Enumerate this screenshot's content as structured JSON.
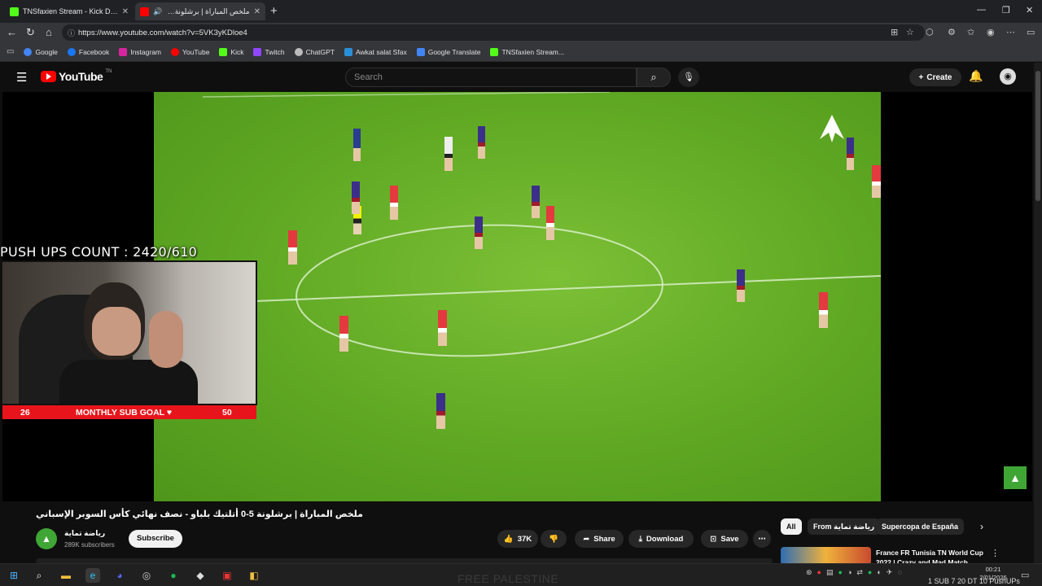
{
  "browser": {
    "tabs": [
      {
        "title": "TNSfaxien Stream - Kick Dashboar",
        "color": "#53fc18"
      },
      {
        "title": "ملخص المباراة | برشلونة 5-0 أتل",
        "color": "#ff0000"
      }
    ],
    "url": "https://www.youtube.com/watch?v=5VK3yKDloe4",
    "bookmarks": [
      {
        "label": "Google",
        "color": "#4285f4"
      },
      {
        "label": "Facebook",
        "color": "#1877f2"
      },
      {
        "label": "Instagram",
        "color": "#d6249f"
      },
      {
        "label": "YouTube",
        "color": "#ff0000"
      },
      {
        "label": "Kick",
        "color": "#53fc18"
      },
      {
        "label": "Twitch",
        "color": "#9146ff"
      },
      {
        "label": "ChatGPT",
        "color": "#bbbbbb"
      },
      {
        "label": "Awkat salat Sfax",
        "color": "#2a8fd6"
      },
      {
        "label": "Google Translate",
        "color": "#4285f4"
      },
      {
        "label": "TNSfaxien Stream...",
        "color": "#53fc18"
      }
    ]
  },
  "youtube": {
    "logo_text": "YouTube",
    "logo_suffix": "TN",
    "search_placeholder": "Search",
    "create_label": "Create"
  },
  "overlay": {
    "pushups_text": "PUSH UPS COUNT : 2420/610",
    "subgoal_current": "26",
    "subgoal_label": "MONTHLY SUB GOAL ♥",
    "subgoal_target": "50"
  },
  "video": {
    "title": "ملخص المباراة | برشلونة 5-0 أتلتيك بلباو - نصف نهائي كأس السوبر الإسباني",
    "channel_name": "رياضة تماية",
    "channel_subs": "289K subscribers",
    "subscribe_label": "Subscribe",
    "likes": "37K",
    "share_label": "Share",
    "download_label": "Download",
    "save_label": "Save"
  },
  "sidebar": {
    "chips": [
      {
        "label": "All",
        "selected": true
      },
      {
        "label": "From رياضة تماية",
        "selected": false
      },
      {
        "label": "Supercopa de España",
        "selected": false
      }
    ],
    "recommendation_title": "France FR Tunisia TN World Cup 2022 | Crazy and Mad Match"
  },
  "taskbar": {
    "watermark": "FREE PALESTINE",
    "clock_time": "00:21",
    "clock_date": "2/01/2026",
    "ticker": "1 SUB 7 20 DT  10 PushUPs"
  }
}
